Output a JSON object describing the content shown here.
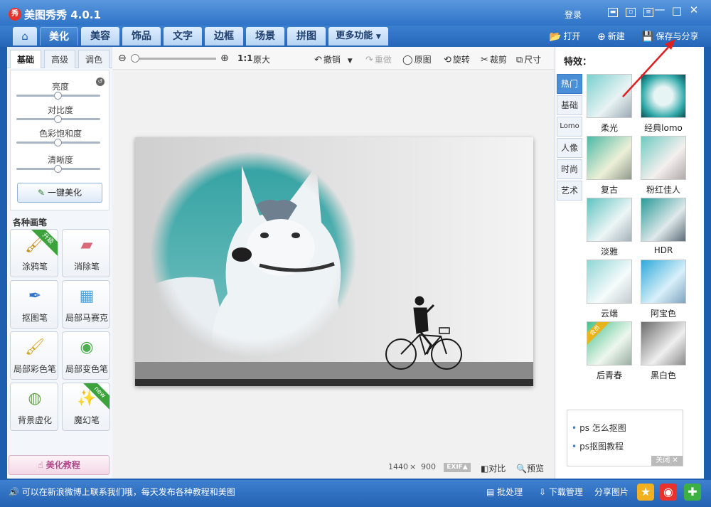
{
  "app": {
    "logo_glyph": "秀",
    "title": "美图秀秀 4.0.1",
    "login": "登录"
  },
  "nav": {
    "tabs": [
      "美化",
      "美容",
      "饰品",
      "文字",
      "边框",
      "场景",
      "拼图"
    ],
    "more": "更多功能",
    "open": "打开",
    "new": "新建",
    "save_share": "保存与分享"
  },
  "left": {
    "subtabs": [
      "基础",
      "高级",
      "调色"
    ],
    "sliders": [
      {
        "label": "亮度",
        "value": 0.5
      },
      {
        "label": "对比度",
        "value": 0.5
      },
      {
        "label": "色彩饱和度",
        "value": 0.5
      },
      {
        "label": "清晰度",
        "value": 0.5
      }
    ],
    "one_key": "一键美化",
    "brushes_title": "各种画笔",
    "brushes": [
      {
        "label": "涂鸦笔",
        "badge": "升级"
      },
      {
        "label": "消除笔",
        "badge": ""
      },
      {
        "label": "抠图笔",
        "badge": ""
      },
      {
        "label": "局部马赛克",
        "badge": ""
      },
      {
        "label": "局部彩色笔",
        "badge": ""
      },
      {
        "label": "局部变色笔",
        "badge": ""
      },
      {
        "label": "背景虚化",
        "badge": ""
      },
      {
        "label": "魔幻笔",
        "badge": "new"
      }
    ],
    "tutorial": "美化教程"
  },
  "toolbar": {
    "ratio": "1:1",
    "original_size": "原大",
    "undo": "撤销",
    "redo": "重做",
    "original": "原图",
    "rotate": "旋转",
    "crop": "裁剪",
    "size": "尺寸",
    "zoom": 0.0
  },
  "image_info": {
    "width": "1440",
    "times": "×",
    "height": "900",
    "exif": "EXIF▲",
    "compare": "对比",
    "preview": "预览"
  },
  "effects": {
    "title": "特效：",
    "categories": [
      "热门",
      "基础",
      "Lomo",
      "人像",
      "时尚",
      "艺术"
    ],
    "items": [
      {
        "label": "柔光",
        "badge": ""
      },
      {
        "label": "经典lomo",
        "badge": ""
      },
      {
        "label": "复古",
        "badge": ""
      },
      {
        "label": "粉红佳人",
        "badge": ""
      },
      {
        "label": "淡雅",
        "badge": ""
      },
      {
        "label": "HDR",
        "badge": ""
      },
      {
        "label": "云端",
        "badge": ""
      },
      {
        "label": "阿宝色",
        "badge": ""
      },
      {
        "label": "后青春",
        "badge": "会员"
      },
      {
        "label": "黑白色",
        "badge": ""
      }
    ]
  },
  "news": {
    "items": [
      "ps 怎么抠图",
      "ps抠图教程"
    ],
    "close": "关闭 ✕"
  },
  "status": {
    "message": "可以在新浪微博上联系我们哦，每天发布各种教程和美图",
    "batch": "批处理",
    "download": "下载管理",
    "share": "分享图片"
  },
  "colors": {
    "accent": "#2f74c8",
    "arrow": "#e02020"
  }
}
